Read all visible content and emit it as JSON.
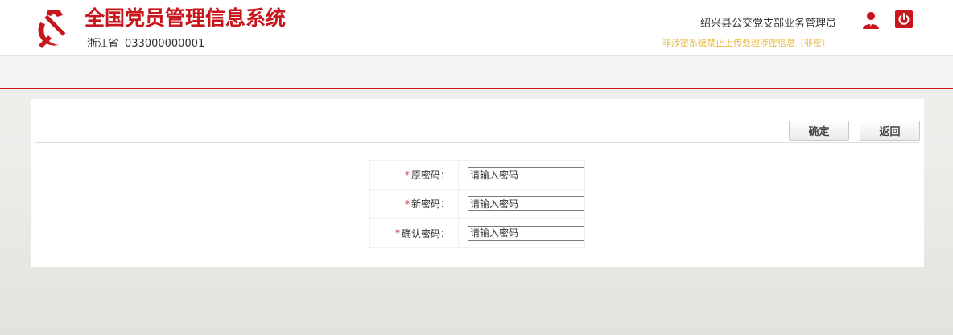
{
  "header": {
    "system_title": "全国党员管理信息系统",
    "province": "浙江省",
    "org_code": "033000000001",
    "user_name": "绍兴县公交党支部业务管理员",
    "secret_notice": "非涉密系统禁止上传处理涉密信息（非密）",
    "icons": {
      "logo": "party-emblem-icon",
      "user": "user-icon",
      "logout": "power-icon"
    },
    "colors": {
      "brand_red": "#c8161d",
      "notice_yellow": "#e8b73a"
    }
  },
  "toolbar": {
    "confirm_label": "确定",
    "back_label": "返回"
  },
  "form": {
    "required_mark": "*",
    "old_password": {
      "label": "原密码：",
      "placeholder": "请输入密码"
    },
    "new_password": {
      "label": "新密码：",
      "placeholder": "请输入密码"
    },
    "confirm_password": {
      "label": "确认密码：",
      "placeholder": "请输入密码"
    }
  }
}
